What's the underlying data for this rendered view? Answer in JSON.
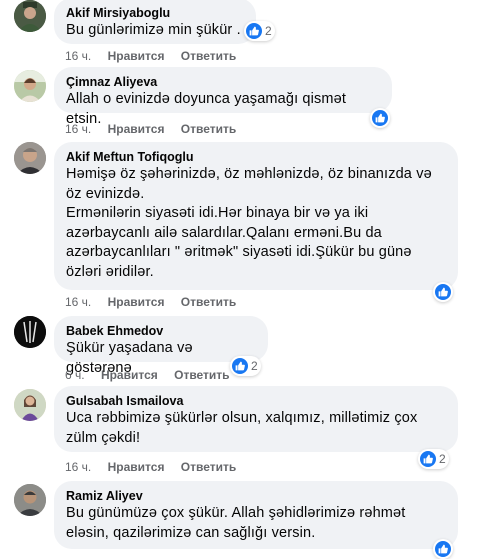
{
  "actions": {
    "like": "Нравится",
    "reply": "Ответить"
  },
  "comments": [
    {
      "author": "Akif Mirsiyaboglu",
      "text": "Bu günlərimizə min şükür .",
      "time": "16 ч.",
      "reactions": "2"
    },
    {
      "author": "Çimnaz Aliyeva",
      "text": "Allah o evinizdə doyunca yaşamağı qismət etsin.",
      "time": "16 ч.",
      "reactions": ""
    },
    {
      "author": "Akif Meftun Tofiqoglu",
      "text": "Həmişə öz şəhərinizdə, öz məhlənizdə, öz binanızda və\nöz evinizdə.\nErmənilərin siyasəti idi.Hər binaya bir və ya iki\nazərbaycanlı ailə salardılar.Qalanı ermənі.Bu da\nazərbaycanlıları \" əritmək\" siyasəti idi.Şükür bu günə\nözləri əridilər.",
      "time": "16 ч.",
      "reactions": ""
    },
    {
      "author": "Babek Ehmedov",
      "text": "Şükür yaşadana və göstərənə",
      "time": "6 ч.",
      "reactions": "2"
    },
    {
      "author": "Gulsabah Ismailova",
      "text": "Uca rəbbimizə şükürlər olsun, xalqımız, millətimiz çox\nzülm çəkdi!",
      "time": "16 ч.",
      "reactions": "2"
    },
    {
      "author": "Ramiz Aliyev",
      "text": "Bu günümüzə çox şükür. Allah şəhidlərimizə rəhmət\neləsin, qazilərimizə can sağlığı versin.",
      "time": "",
      "reactions": ""
    }
  ]
}
